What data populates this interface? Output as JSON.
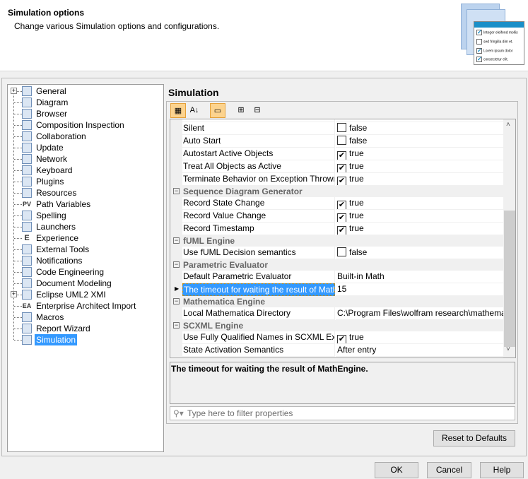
{
  "header": {
    "title": "Simulation options",
    "subtitle": "Change various Simulation options and configurations.",
    "illustration_text": [
      "Integer eleifend mollis",
      "sed fringilla dim et.",
      "Lorem ipsum dolor",
      "consectetur elit."
    ]
  },
  "tree": {
    "items": [
      {
        "label": "General",
        "icon": "general-icon",
        "expandable": true
      },
      {
        "label": "Diagram",
        "icon": "diagram-icon"
      },
      {
        "label": "Browser",
        "icon": "browser-icon"
      },
      {
        "label": "Composition Inspection",
        "icon": "composition-inspection-icon"
      },
      {
        "label": "Collaboration",
        "icon": "collaboration-icon"
      },
      {
        "label": "Update",
        "icon": "update-icon"
      },
      {
        "label": "Network",
        "icon": "network-icon"
      },
      {
        "label": "Keyboard",
        "icon": "keyboard-icon"
      },
      {
        "label": "Plugins",
        "icon": "plugins-icon"
      },
      {
        "label": "Resources",
        "icon": "resources-icon"
      },
      {
        "label": "Path Variables",
        "icon": "path-variables-icon",
        "glyph": "PV"
      },
      {
        "label": "Spelling",
        "icon": "spelling-icon"
      },
      {
        "label": "Launchers",
        "icon": "launchers-icon"
      },
      {
        "label": "Experience",
        "icon": "experience-icon",
        "glyph": "E"
      },
      {
        "label": "External Tools",
        "icon": "external-tools-icon"
      },
      {
        "label": "Notifications",
        "icon": "notifications-icon"
      },
      {
        "label": "Code Engineering",
        "icon": "code-engineering-icon"
      },
      {
        "label": "Document Modeling",
        "icon": "document-modeling-icon"
      },
      {
        "label": "Eclipse UML2 XMI",
        "icon": "eclipse-uml2-xmi-icon",
        "expandable": true
      },
      {
        "label": "Enterprise Architect Import",
        "icon": "enterprise-architect-icon",
        "glyph": "EA"
      },
      {
        "label": "Macros",
        "icon": "macros-icon"
      },
      {
        "label": "Report Wizard",
        "icon": "report-wizard-icon"
      },
      {
        "label": "Simulation",
        "icon": "simulation-icon",
        "selected": true
      }
    ]
  },
  "panel": {
    "title": "Simulation",
    "toolbar": [
      {
        "name": "categorized-view",
        "active": true,
        "glyph": "▦"
      },
      {
        "name": "sort-alphabetically",
        "glyph": "A↓"
      },
      {
        "name": "show-descriptions",
        "active": true,
        "glyph": "▭"
      },
      {
        "name": "expand-all",
        "glyph": "⊞"
      },
      {
        "name": "collapse-all",
        "glyph": "⊟"
      }
    ],
    "rows": [
      {
        "type": "prop",
        "name": "Silent",
        "value": "false",
        "checkbox": true,
        "checked": false
      },
      {
        "type": "prop",
        "name": "Auto Start",
        "value": "false",
        "checkbox": true,
        "checked": false
      },
      {
        "type": "prop",
        "name": "Autostart Active Objects",
        "value": "true",
        "checkbox": true,
        "checked": true
      },
      {
        "type": "prop",
        "name": "Treat All Objects as Active",
        "value": "true",
        "checkbox": true,
        "checked": true
      },
      {
        "type": "prop",
        "name": "Terminate Behavior on Exception Thrown",
        "value": "true",
        "checkbox": true,
        "checked": true
      },
      {
        "type": "group",
        "name": "Sequence Diagram Generator"
      },
      {
        "type": "prop",
        "name": "Record State Change",
        "value": "true",
        "checkbox": true,
        "checked": true
      },
      {
        "type": "prop",
        "name": "Record Value Change",
        "value": "true",
        "checkbox": true,
        "checked": true
      },
      {
        "type": "prop",
        "name": "Record Timestamp",
        "value": "true",
        "checkbox": true,
        "checked": true
      },
      {
        "type": "group",
        "name": "fUML Engine"
      },
      {
        "type": "prop",
        "name": "Use fUML Decision semantics",
        "value": "false",
        "checkbox": true,
        "checked": false
      },
      {
        "type": "group",
        "name": "Parametric Evaluator"
      },
      {
        "type": "prop",
        "name": "Default Parametric Evaluator",
        "value": "Built-in Math"
      },
      {
        "type": "prop",
        "name": "The timeout for waiting the result of Math…",
        "value": "15",
        "selected": true
      },
      {
        "type": "group",
        "name": "Mathematica Engine"
      },
      {
        "type": "prop",
        "name": "Local Mathematica Directory",
        "value": "C:\\Program Files\\wolfram research\\mathematica\\"
      },
      {
        "type": "group",
        "name": "SCXML Engine"
      },
      {
        "type": "prop",
        "name": "Use Fully Qualified Names in SCXML Export",
        "value": "true",
        "checkbox": true,
        "checked": true
      },
      {
        "type": "prop",
        "name": "State Activation Semantics",
        "value": "After entry"
      }
    ],
    "description": "The timeout for waiting the result of MathEngine.",
    "filter_placeholder": "Type here to filter properties",
    "reset_label": "Reset to Defaults"
  },
  "buttons": {
    "ok": "OK",
    "cancel": "Cancel",
    "help": "Help"
  },
  "colors": {
    "selection": "#3399ff",
    "toolbar_active": "#fcd38e"
  }
}
